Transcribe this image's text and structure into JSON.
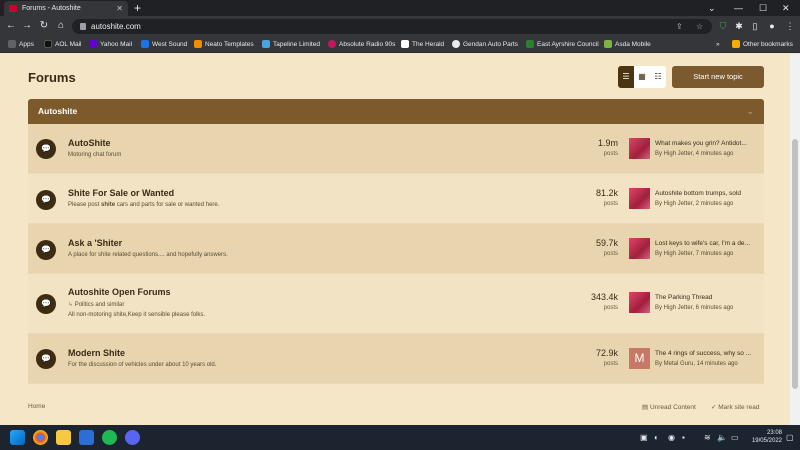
{
  "browser": {
    "tab_title": "Forums - Autoshite",
    "url": "autoshite.com",
    "bookmarks": [
      {
        "label": "Apps",
        "color": "#5f6368"
      },
      {
        "label": "AOL Mail",
        "color": "#111111"
      },
      {
        "label": "Yahoo Mail",
        "color": "#6001d2"
      },
      {
        "label": "West Sound",
        "color": "#1a73e8"
      },
      {
        "label": "Neato Templates",
        "color": "#f28b00"
      },
      {
        "label": "Tapeline Limited",
        "color": "#4aa3df"
      },
      {
        "label": "Absolute Radio 90s",
        "color": "#c2185b"
      },
      {
        "label": "The Herald",
        "color": "#ffffff"
      },
      {
        "label": "Gendan Auto Parts",
        "color": "#e8eaed"
      },
      {
        "label": "East Ayrshire Council",
        "color": "#2e7d32"
      },
      {
        "label": "Asda Mobile",
        "color": "#7cb342"
      }
    ],
    "other_bookmarks": "Other bookmarks"
  },
  "page": {
    "title": "Forums",
    "start_new_topic": "Start new topic",
    "category": "Autoshite",
    "forums": [
      {
        "title": "AutoShite",
        "description": "Motoring chat forum",
        "posts": "1.9m",
        "posts_label": "posts",
        "latest_title": "What makes you grin? Antidot...",
        "latest_meta": "By High Jetter, 4 minutes ago",
        "avatar": "image"
      },
      {
        "title": "Shite For Sale or Wanted",
        "description_pre": "Please post ",
        "description_bold": "shite",
        "description_post": " cars and parts for sale or wanted here.",
        "posts": "81.2k",
        "posts_label": "posts",
        "latest_title": "Autoshite bottom trumps, sold",
        "latest_meta": "By High Jetter, 2 minutes ago",
        "avatar": "image"
      },
      {
        "title": "Ask a 'Shiter",
        "description": "A place for shite related questions.... and hopefully answers.",
        "posts": "59.7k",
        "posts_label": "posts",
        "latest_title": "Lost keys to wife's car, I'm a de...",
        "latest_meta": "By High Jetter, 7 minutes ago",
        "avatar": "image"
      },
      {
        "title": "Autoshite Open Forums",
        "subforum": "Politics and similar",
        "description": "All non-motoring shite,Keep it sensible please folks.",
        "posts": "343.4k",
        "posts_label": "posts",
        "latest_title": "The Parking Thread",
        "latest_meta": "By High Jetter, 6 minutes ago",
        "avatar": "image"
      },
      {
        "title": "Modern Shite",
        "description": "For the discussion of vehicles under about 10 years old.",
        "posts": "72.9k",
        "posts_label": "posts",
        "latest_title": "The 4 rings of success, why so ...",
        "latest_meta": "By Metal Guru, 14 minutes ago",
        "avatar": "letter",
        "avatar_letter": "M"
      }
    ],
    "footer": {
      "home": "Home",
      "unread": "Unread Content",
      "mark_read": "Mark site read"
    }
  },
  "taskbar": {
    "time": "23:08",
    "date": "19/05/2022"
  },
  "colors": {
    "page_bg": "#f5e6c8",
    "header_brown": "#7d5a2b",
    "button_brown": "#7a5a2e",
    "icon_dark": "#3d2c12"
  }
}
